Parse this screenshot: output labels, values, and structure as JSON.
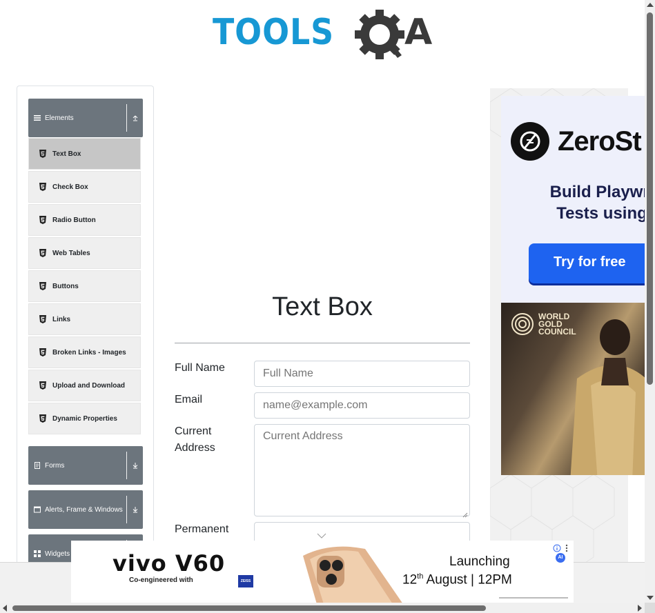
{
  "header": {
    "logo_text": "TOOLSQA"
  },
  "sidebar": {
    "groups": [
      {
        "label": "Elements",
        "expanded": true,
        "icon": "hamburger-icon"
      },
      {
        "label": "Forms",
        "expanded": false,
        "icon": "form-icon"
      },
      {
        "label": "Alerts, Frame & Windows",
        "expanded": false,
        "icon": "window-icon"
      },
      {
        "label": "Widgets",
        "expanded": false,
        "icon": "grid-icon"
      }
    ],
    "elements_items": [
      {
        "label": "Text Box",
        "active": true
      },
      {
        "label": "Check Box"
      },
      {
        "label": "Radio Button"
      },
      {
        "label": "Web Tables"
      },
      {
        "label": "Buttons"
      },
      {
        "label": "Links"
      },
      {
        "label": "Broken Links - Images"
      },
      {
        "label": "Upload and Download"
      },
      {
        "label": "Dynamic Properties"
      }
    ]
  },
  "main": {
    "title": "Text Box",
    "fields": {
      "full_name": {
        "label": "Full Name",
        "placeholder": "Full Name",
        "value": ""
      },
      "email": {
        "label": "Email",
        "placeholder": "name@example.com",
        "value": ""
      },
      "current_address": {
        "label_line1": "Current",
        "label_line2": "Address",
        "placeholder": "Current Address",
        "value": ""
      },
      "permanent_address": {
        "label_line1": "Permanent",
        "value": ""
      }
    }
  },
  "ads": {
    "right_top": {
      "brand": "ZeroSt",
      "headline_line1": "Build Playwri",
      "headline_line2": "Tests using",
      "cta": "Try for free"
    },
    "right_bottom": {
      "org_line1": "WORLD",
      "org_line2": "GOLD",
      "org_line3": "COUNCIL"
    },
    "bottom": {
      "brand": "vivo V60",
      "sub": "Co-engineered with",
      "partner": "ZEISS",
      "launch_line1": "Launching",
      "launch_day": "12",
      "launch_sup": "th",
      "launch_rest": " August  |  12PM",
      "ai_badge": "AI"
    }
  },
  "colors": {
    "primary_blue": "#1798d4",
    "gear_dark": "#3a3a3a",
    "sidebar_header": "#6c757d",
    "menu_item_bg": "#efefef",
    "menu_item_active": "#c6c6c6"
  }
}
